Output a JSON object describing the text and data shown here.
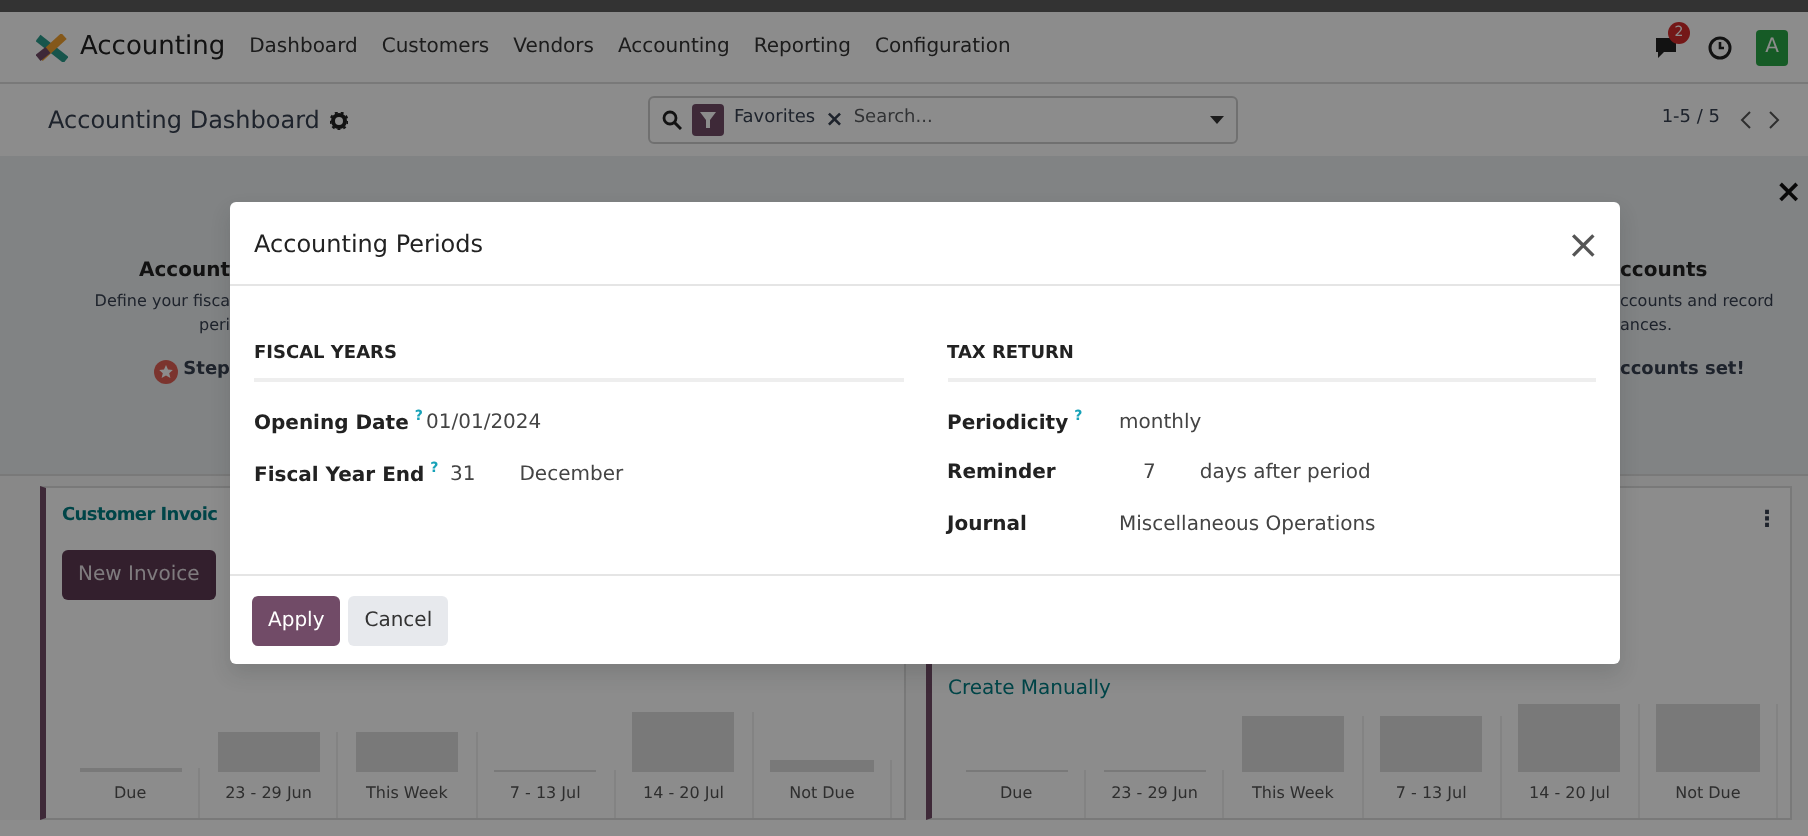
{
  "navbar": {
    "app": "Accounting",
    "menu": [
      "Dashboard",
      "Customers",
      "Vendors",
      "Accounting",
      "Reporting",
      "Configuration"
    ],
    "messages_badge": "2",
    "avatar": "A"
  },
  "control_panel": {
    "title": "Accounting Dashboard",
    "facet": "Favorites",
    "facet_remove": "×",
    "placeholder": "Search...",
    "pager": "1-5 / 5"
  },
  "onboarding": {
    "close": "×",
    "left_step": {
      "title": "Account",
      "lines": [
        "Define your fisca",
        "peri"
      ],
      "action": "Step"
    },
    "right_step": {
      "title": "ccounts",
      "lines": [
        "ccounts and record",
        "ances."
      ],
      "action": "ccounts set!"
    }
  },
  "cards": [
    {
      "title": "Customer Invoic",
      "button": "New Invoice",
      "categories": [
        "Due",
        "23 - 29 Jun",
        "This Week",
        "7 - 13 Jul",
        "14 - 20 Jul",
        "Not Due"
      ]
    },
    {
      "link": "Create Manually",
      "menu": "⋮",
      "categories": [
        "Due",
        "23 - 29 Jun",
        "This Week",
        "7 - 13 Jul",
        "14 - 20 Jul",
        "Not Due"
      ]
    }
  ],
  "dialog": {
    "title": "Accounting Periods",
    "close": "×",
    "sections": [
      {
        "heading": "FISCAL YEARS",
        "fields": [
          {
            "label": "Opening Date",
            "tooltip": "?",
            "values": [
              "01/01/2024"
            ]
          },
          {
            "label": "Fiscal Year End",
            "tooltip": "?",
            "values": [
              "31",
              "December"
            ]
          }
        ]
      },
      {
        "heading": "TAX RETURN",
        "fields": [
          {
            "label": "Periodicity",
            "tooltip": "?",
            "values": [
              "monthly"
            ]
          },
          {
            "label": "Reminder",
            "values": [
              "7",
              "days after period"
            ]
          },
          {
            "label": "Journal",
            "values": [
              "Miscellaneous Operations"
            ]
          }
        ]
      }
    ],
    "buttons": [
      {
        "label": "Apply",
        "kind": "primary"
      },
      {
        "label": "Cancel",
        "kind": "secondary"
      }
    ]
  }
}
